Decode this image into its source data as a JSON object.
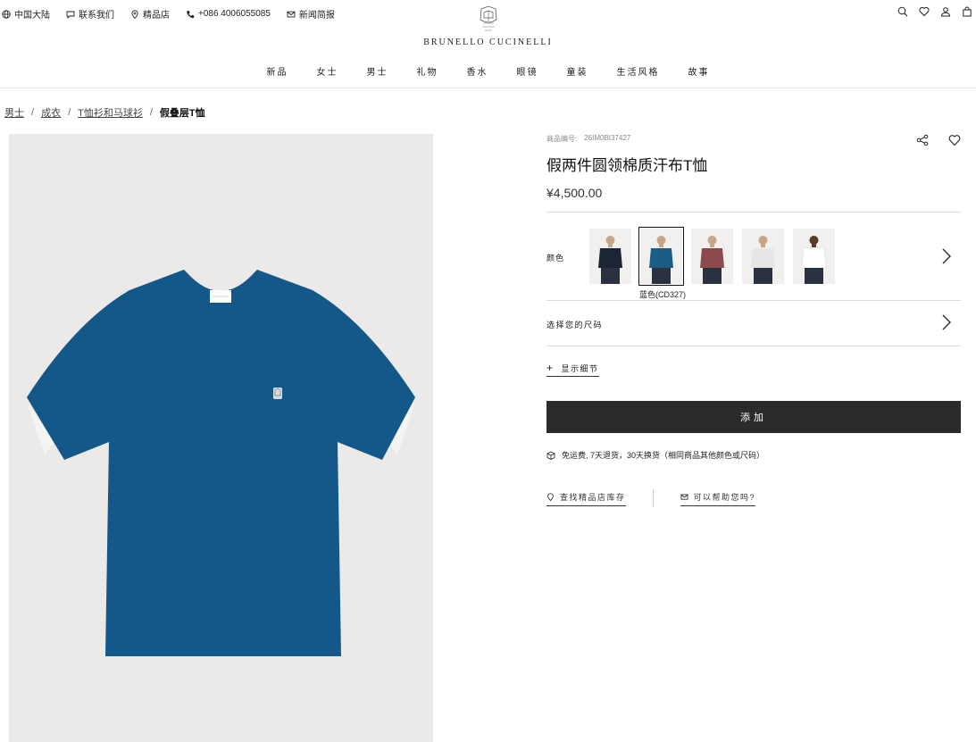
{
  "utility": {
    "region": "中国大陆",
    "contact": "联系我们",
    "stores": "精品店",
    "phone": "+086 4006055085",
    "newsletter": "新闻简报"
  },
  "brand": {
    "name": "BRUNELLO CUCINELLI"
  },
  "nav": [
    "新品",
    "女士",
    "男士",
    "礼物",
    "香水",
    "眼镜",
    "童装",
    "生活风格",
    "故事"
  ],
  "breadcrumb": {
    "items": [
      "男士",
      "成衣",
      "T恤衫和马球衫"
    ],
    "current": "假叠层T恤",
    "separator": "/"
  },
  "product": {
    "sku_label": "商品编号:",
    "sku": "26IM0BI37427",
    "title": "假两件圆领棉质汗布T恤",
    "price": "¥4,500.00",
    "color_label": "颜色",
    "selected_color": "蓝色(CD327)",
    "swatches": [
      {
        "color": "#1c2533",
        "name": "navy"
      },
      {
        "color": "#1a5d86",
        "name": "blue",
        "selected": true
      },
      {
        "color": "#8a4a4e",
        "name": "burgundy"
      },
      {
        "color": "#e6e6e4",
        "name": "light-grey"
      },
      {
        "color": "#ffffff",
        "name": "white"
      }
    ],
    "size_label": "选择您的尺码",
    "details_label": "显示细节",
    "add_label": "添加",
    "shipping": "免运费, 7天退货，30天换货（相同商品其他颜色或尺码）",
    "store_stock": "查找精品店库存",
    "help": "可以帮助您吗?",
    "tee_color": "#14588a"
  }
}
